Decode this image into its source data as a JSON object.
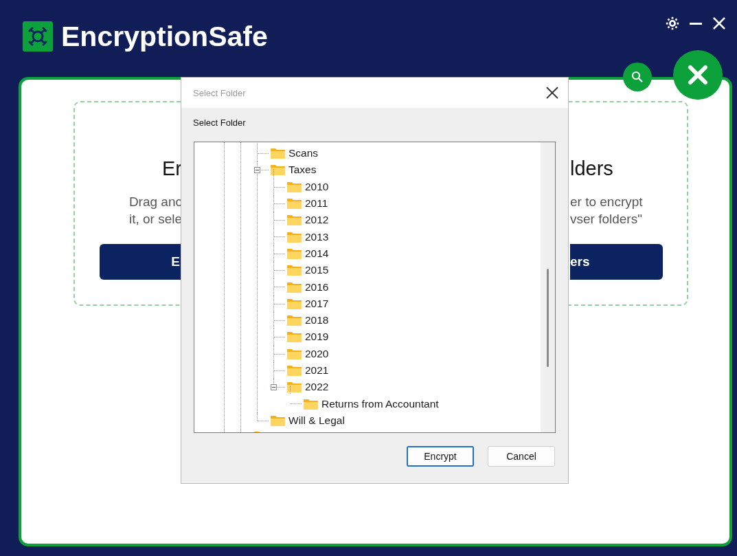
{
  "app": {
    "title": "EncryptionSafe"
  },
  "card": {
    "heading_left": "Er",
    "heading_right": "lders",
    "text_left": [
      "Drag anc",
      "it, or sele"
    ],
    "text_right": [
      "er to encrypt",
      "vser folders\""
    ],
    "button_left": "E",
    "button_right": "ers"
  },
  "dialog": {
    "title": "Select Folder",
    "label": "Select Folder",
    "tree": [
      {
        "name": "Scans"
      },
      {
        "name": "Taxes",
        "expanded": true,
        "children": [
          {
            "name": "2010"
          },
          {
            "name": "2011"
          },
          {
            "name": "2012"
          },
          {
            "name": "2013"
          },
          {
            "name": "2014"
          },
          {
            "name": "2015"
          },
          {
            "name": "2016"
          },
          {
            "name": "2017"
          },
          {
            "name": "2018"
          },
          {
            "name": "2019"
          },
          {
            "name": "2020"
          },
          {
            "name": "2021"
          },
          {
            "name": "2022",
            "expanded": true,
            "children": [
              {
                "name": "Returns from Accountant"
              }
            ]
          }
        ]
      },
      {
        "name": "Will & Legal"
      }
    ],
    "buttons": [
      {
        "label": "Encrypt",
        "kind": "primary"
      },
      {
        "label": "Cancel",
        "kind": "secondary"
      }
    ]
  }
}
